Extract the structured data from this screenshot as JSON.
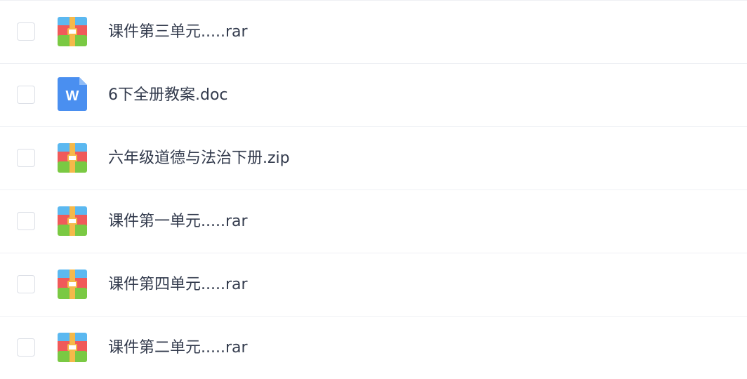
{
  "colors": {
    "text": "#333b4d",
    "divider": "#eef0f4",
    "checkbox_border": "#dcdfe6",
    "archive_top": "#5bb8f0",
    "archive_middle": "#f05a5a",
    "archive_bottom": "#7ac943",
    "archive_strap": "#f5b94a",
    "word_blue": "#4a8ff0"
  },
  "files": [
    {
      "name": "课件第三单元.....rar",
      "icon": "archive-icon"
    },
    {
      "name": "6下全册教案.doc",
      "icon": "word-doc-icon"
    },
    {
      "name": "六年级道德与法治下册.zip",
      "icon": "archive-icon"
    },
    {
      "name": "课件第一单元.....rar",
      "icon": "archive-icon"
    },
    {
      "name": "课件第四单元.....rar",
      "icon": "archive-icon"
    },
    {
      "name": "课件第二单元.....rar",
      "icon": "archive-icon"
    }
  ]
}
